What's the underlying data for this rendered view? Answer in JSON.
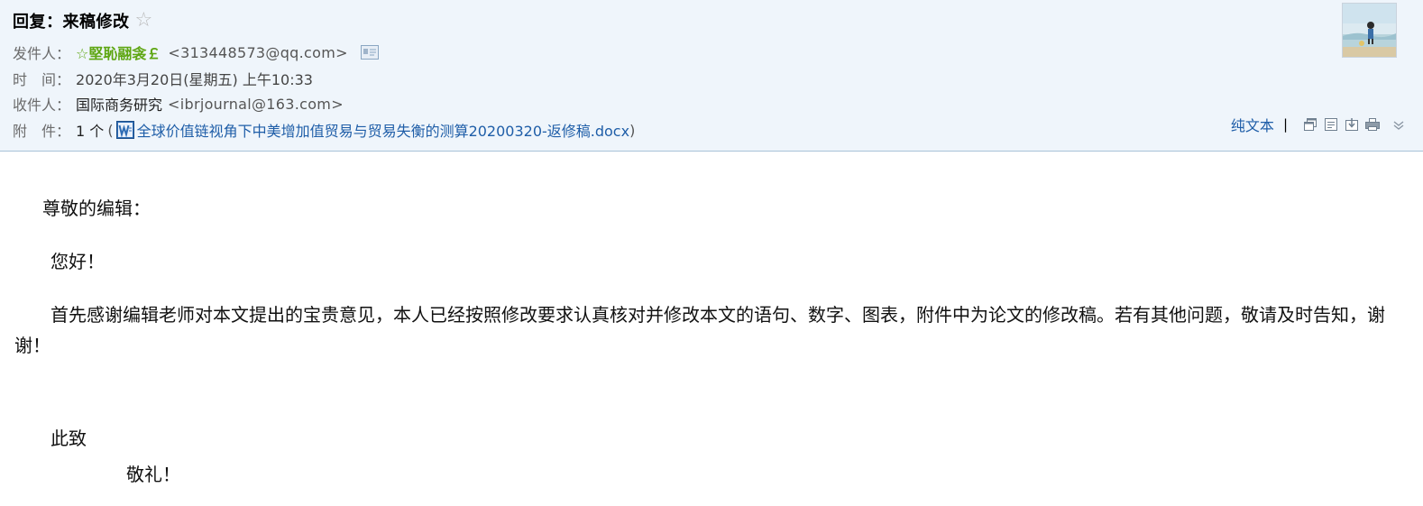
{
  "email": {
    "subject": "回复：来稿修改",
    "sender": {
      "label": "发件人",
      "name": "☆堅恥翮衾￡",
      "address": "<313448573@qq.com>"
    },
    "time": {
      "label": "时　间",
      "value": "2020年3月20日(星期五) 上午10:33"
    },
    "recipient": {
      "label": "收件人",
      "name": "国际商务研究",
      "address": "<ibrjournal@163.com>"
    },
    "attachment": {
      "label": "附　件",
      "count": "1 个",
      "open_paren": "(",
      "filename": "全球价值链视角下中美增加值贸易与贸易失衡的测算20200320-返修稿.docx",
      "close_paren": ")"
    },
    "colon": "："
  },
  "toolbar": {
    "plain_text_label": "纯文本",
    "divider": "|",
    "icons": [
      "new-window-icon",
      "memo-icon",
      "download-icon",
      "print-icon",
      "chevron-down-icon"
    ]
  },
  "body": {
    "greeting": "尊敬的编辑：",
    "hello": "您好！",
    "main": "首先感谢编辑老师对本文提出的宝贵意见，本人已经按照修改要求认真核对并修改本文的语句、数字、图表，附件中为论文的修改稿。若有其他问题，敬请及时告知，谢谢！",
    "closing1": "此致",
    "closing2": "敬礼！"
  },
  "colors": {
    "header_bg": "#eff5fb",
    "sender_green": "#5ea612",
    "link_blue": "#1f5ea8"
  }
}
